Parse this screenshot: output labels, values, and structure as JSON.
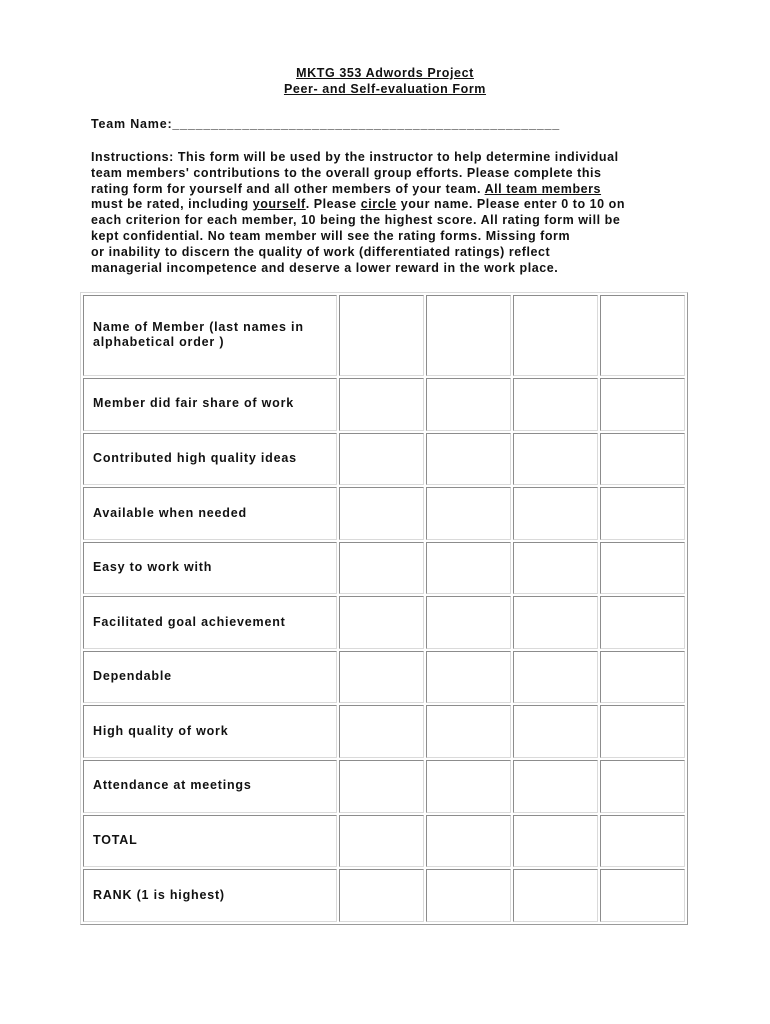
{
  "document": {
    "title_line1": "MKTG 353 Adwords Project",
    "title_line2": "Peer- and Self-evaluation Form",
    "team_name_label": "Team Name:",
    "team_name_blank": "__________________________________________________",
    "instructions": {
      "line1": "Instructions: This form will be used by the instructor to help determine individual",
      "line2": "team members' contributions to the overall group efforts. Please complete this",
      "line3_pre": "rating form for yourself and all other members of your team. ",
      "line3_u": "All team members",
      "line4_pre": "must be rated, including ",
      "line4_u1": "yourself",
      "line4_mid": ". Please ",
      "line4_u2": "circle",
      "line4_post": " your name. Please enter 0 to 10 on",
      "line5": "each criterion for each member, 10 being the highest score. All rating form will be",
      "line6": "kept confidential. No team member will see the rating forms. Missing form",
      "line7": "or inability to discern the quality of work (differentiated ratings) reflect",
      "line8": "managerial incompetence and deserve a lower reward in the work place."
    }
  },
  "table": {
    "header_label": "Name of Member (last names in alphabetical order )",
    "member_columns": [
      "",
      "",
      "",
      ""
    ],
    "rows": [
      {
        "label": "Member did fair share of work",
        "values": [
          "",
          "",
          "",
          ""
        ]
      },
      {
        "label": "Contributed high quality ideas",
        "values": [
          "",
          "",
          "",
          ""
        ]
      },
      {
        "label": "Available when needed",
        "values": [
          "",
          "",
          "",
          ""
        ]
      },
      {
        "label": "Easy to work with",
        "values": [
          "",
          "",
          "",
          ""
        ]
      },
      {
        "label": "Facilitated goal achievement",
        "values": [
          "",
          "",
          "",
          ""
        ]
      },
      {
        "label": "Dependable",
        "values": [
          "",
          "",
          "",
          ""
        ]
      },
      {
        "label": "High quality of work",
        "values": [
          "",
          "",
          "",
          ""
        ]
      },
      {
        "label": "Attendance at meetings",
        "values": [
          "",
          "",
          "",
          ""
        ]
      },
      {
        "label": "TOTAL",
        "values": [
          "",
          "",
          "",
          ""
        ]
      },
      {
        "label": "RANK (1 is highest)",
        "values": [
          "",
          "",
          "",
          ""
        ]
      }
    ]
  }
}
